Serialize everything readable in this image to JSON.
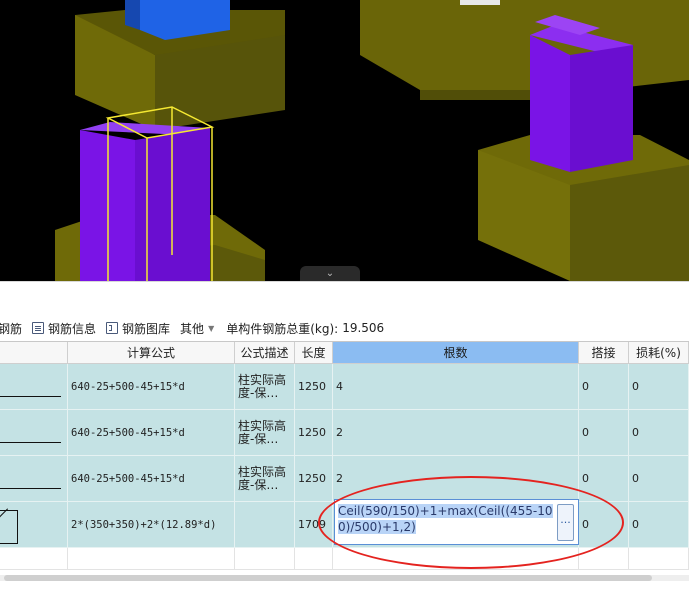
{
  "toolbar": {
    "items": [
      {
        "label": "钢筋",
        "icon": "cut-off-icon"
      },
      {
        "label": "钢筋信息",
        "icon": "rebar-info-icon"
      },
      {
        "label": "钢筋图库",
        "icon": "rebar-library-icon"
      },
      {
        "label": "其他",
        "icon": "dropdown-icon"
      }
    ],
    "total_label": "单构件钢筋总重(kg):",
    "total_value": "19.506"
  },
  "grid": {
    "headers": [
      "计算公式",
      "公式描述",
      "长度",
      "根数",
      "搭接",
      "损耗(%)"
    ],
    "rows": [
      {
        "formula": "640-25+500-45+15*d",
        "desc": "柱实际高度-保…",
        "length": "1250",
        "count": "4",
        "splice": "0",
        "loss": "0"
      },
      {
        "formula": "640-25+500-45+15*d",
        "desc": "柱实际高度-保…",
        "length": "1250",
        "count": "2",
        "splice": "0",
        "loss": "0"
      },
      {
        "formula": "640-25+500-45+15*d",
        "desc": "柱实际高度-保…",
        "length": "1250",
        "count": "2",
        "splice": "0",
        "loss": "0"
      },
      {
        "formula": "2*(350+350)+2*(12.89*d)",
        "desc": "",
        "length": "1709",
        "count": "",
        "splice": "0",
        "loss": "0"
      }
    ],
    "editor_value": "Ceil(590/150)+1+max(Ceil((455-100)/500)+1,2)",
    "editor_button": "..."
  },
  "viewport": {
    "collapse_icon": "chevron-down-icon"
  },
  "colors": {
    "row_bg": "#c4e2e4",
    "active_header": "#8bbcf2",
    "annotation": "#e4231f",
    "column_purple": "#7a14e6",
    "footing_olive": "#6f6a08",
    "selected_outline": "#f5e832"
  }
}
